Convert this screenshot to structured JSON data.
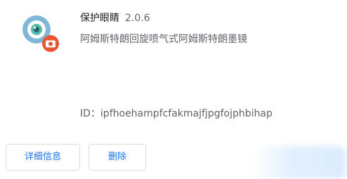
{
  "extension": {
    "icon": "eye-icon",
    "badge_icon": "camera-badge-icon",
    "name": "保护眼睛",
    "version": "2.0.6",
    "description": "阿姆斯特朗回旋喷气式阿姆斯特朗墨镜",
    "id_label": "ID：",
    "id": "ipfhoehampfcfakmajfjpgfojphbihap"
  },
  "buttons": {
    "details_label": "详细信息",
    "remove_label": "删除"
  },
  "colors": {
    "icon_ring": "#7fb8d6",
    "icon_iris": "#4fbfa8",
    "badge": "#e8562f",
    "button_text": "#1a73e8",
    "button_border": "#dadce0"
  }
}
